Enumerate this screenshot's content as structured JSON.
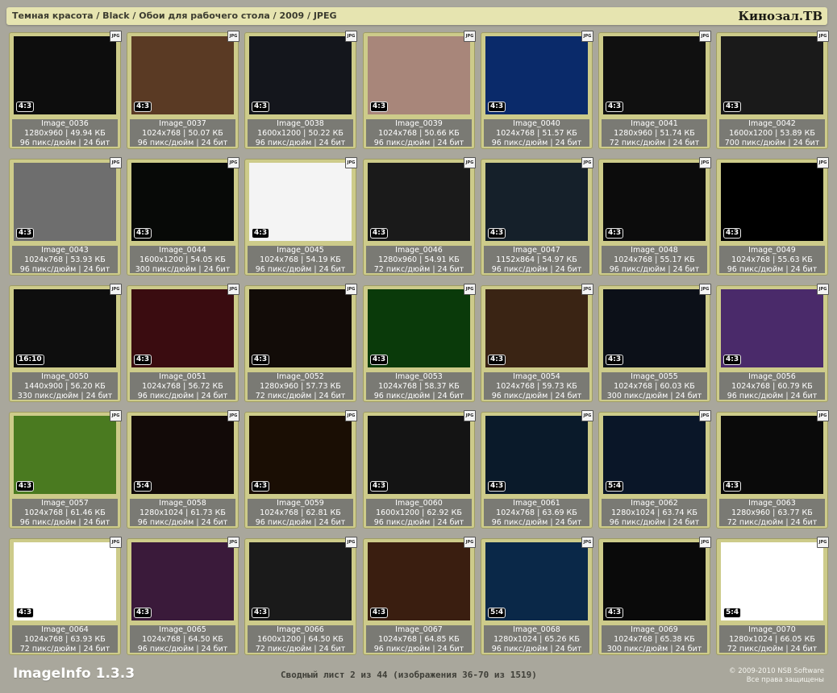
{
  "header": {
    "breadcrumb": "Темная красота / Black / Обои для рабочего стола / 2009 / JPEG",
    "logo": "Кинозал.ТВ"
  },
  "images": [
    {
      "name": "Image_0036",
      "dims": "1280x960 | 49.94 КБ",
      "meta": "96 пикс/дюйм | 24 бит",
      "ratio": "4:3",
      "fmt": "JPG",
      "bg": "#0d0d0d"
    },
    {
      "name": "Image_0037",
      "dims": "1024x768 | 50.07 КБ",
      "meta": "96 пикс/дюйм | 24 бит",
      "ratio": "4:3",
      "fmt": "JPG",
      "bg": "#5a3a24"
    },
    {
      "name": "Image_0038",
      "dims": "1600x1200 | 50.22 КБ",
      "meta": "96 пикс/дюйм | 24 бит",
      "ratio": "4:3",
      "fmt": "JPG",
      "bg": "#14161c"
    },
    {
      "name": "Image_0039",
      "dims": "1024x768 | 50.66 КБ",
      "meta": "96 пикс/дюйм | 24 бит",
      "ratio": "4:3",
      "fmt": "JPG",
      "bg": "#a8867a"
    },
    {
      "name": "Image_0040",
      "dims": "1024x768 | 51.57 КБ",
      "meta": "96 пикс/дюйм | 24 бит",
      "ratio": "4:3",
      "fmt": "JPG",
      "bg": "#0a2a6a"
    },
    {
      "name": "Image_0041",
      "dims": "1280x960 | 51.74 КБ",
      "meta": "72 пикс/дюйм | 24 бит",
      "ratio": "4:3",
      "fmt": "JPG",
      "bg": "#101010"
    },
    {
      "name": "Image_0042",
      "dims": "1600x1200 | 53.89 КБ",
      "meta": "700 пикс/дюйм | 24 бит",
      "ratio": "4:3",
      "fmt": "JPG",
      "bg": "#1a1a1a"
    },
    {
      "name": "Image_0043",
      "dims": "1024x768 | 53.93 КБ",
      "meta": "96 пикс/дюйм | 24 бит",
      "ratio": "4:3",
      "fmt": "JPG",
      "bg": "#6e6e6e"
    },
    {
      "name": "Image_0044",
      "dims": "1600x1200 | 54.05 КБ",
      "meta": "300 пикс/дюйм | 24 бит",
      "ratio": "4:3",
      "fmt": "JPG",
      "bg": "#070907"
    },
    {
      "name": "Image_0045",
      "dims": "1024x768 | 54.19 КБ",
      "meta": "96 пикс/дюйм | 24 бит",
      "ratio": "4:3",
      "fmt": "JPG",
      "bg": "#f4f4f4"
    },
    {
      "name": "Image_0046",
      "dims": "1280x960 | 54.91 КБ",
      "meta": "72 пикс/дюйм | 24 бит",
      "ratio": "4:3",
      "fmt": "JPG",
      "bg": "#1a1a1a"
    },
    {
      "name": "Image_0047",
      "dims": "1152x864 | 54.97 КБ",
      "meta": "96 пикс/дюйм | 24 бит",
      "ratio": "4:3",
      "fmt": "JPG",
      "bg": "#15202a"
    },
    {
      "name": "Image_0048",
      "dims": "1024x768 | 55.17 КБ",
      "meta": "96 пикс/дюйм | 24 бит",
      "ratio": "4:3",
      "fmt": "JPG",
      "bg": "#0c0c0c"
    },
    {
      "name": "Image_0049",
      "dims": "1024x768 | 55.63 КБ",
      "meta": "96 пикс/дюйм | 24 бит",
      "ratio": "4:3",
      "fmt": "JPG",
      "bg": "#000000"
    },
    {
      "name": "Image_0050",
      "dims": "1440x900 | 56.20 КБ",
      "meta": "330 пикс/дюйм | 24 бит",
      "ratio": "16:10",
      "fmt": "JPG",
      "bg": "#0e0e0e"
    },
    {
      "name": "Image_0051",
      "dims": "1024x768 | 56.72 КБ",
      "meta": "96 пикс/дюйм | 24 бит",
      "ratio": "4:3",
      "fmt": "JPG",
      "bg": "#3a0c10"
    },
    {
      "name": "Image_0052",
      "dims": "1280x960 | 57.73 КБ",
      "meta": "72 пикс/дюйм | 24 бит",
      "ratio": "4:3",
      "fmt": "JPG",
      "bg": "#120c08"
    },
    {
      "name": "Image_0053",
      "dims": "1024x768 | 58.37 КБ",
      "meta": "96 пикс/дюйм | 24 бит",
      "ratio": "4:3",
      "fmt": "JPG",
      "bg": "#0a3a0a"
    },
    {
      "name": "Image_0054",
      "dims": "1024x768 | 59.73 КБ",
      "meta": "96 пикс/дюйм | 24 бит",
      "ratio": "4:3",
      "fmt": "JPG",
      "bg": "#3a2414"
    },
    {
      "name": "Image_0055",
      "dims": "1024x768 | 60.03 КБ",
      "meta": "300 пикс/дюйм | 24 бит",
      "ratio": "4:3",
      "fmt": "JPG",
      "bg": "#0c1018"
    },
    {
      "name": "Image_0056",
      "dims": "1024x768 | 60.79 КБ",
      "meta": "96 пикс/дюйм | 24 бит",
      "ratio": "4:3",
      "fmt": "JPG",
      "bg": "#4a2a6a"
    },
    {
      "name": "Image_0057",
      "dims": "1024x768 | 61.46 КБ",
      "meta": "96 пикс/дюйм | 24 бит",
      "ratio": "4:3",
      "fmt": "JPG",
      "bg": "#4a7a20"
    },
    {
      "name": "Image_0058",
      "dims": "1280x1024 | 61.73 КБ",
      "meta": "96 пикс/дюйм | 24 бит",
      "ratio": "5:4",
      "fmt": "JPG",
      "bg": "#120a08"
    },
    {
      "name": "Image_0059",
      "dims": "1024x768 | 62.81 КБ",
      "meta": "96 пикс/дюйм | 24 бит",
      "ratio": "4:3",
      "fmt": "JPG",
      "bg": "#1a0e04"
    },
    {
      "name": "Image_0060",
      "dims": "1600x1200 | 62.92 КБ",
      "meta": "96 пикс/дюйм | 24 бит",
      "ratio": "4:3",
      "fmt": "JPG",
      "bg": "#141414"
    },
    {
      "name": "Image_0061",
      "dims": "1024x768 | 63.69 КБ",
      "meta": "96 пикс/дюйм | 24 бит",
      "ratio": "4:3",
      "fmt": "JPG",
      "bg": "#0a1a2a"
    },
    {
      "name": "Image_0062",
      "dims": "1280x1024 | 63.74 КБ",
      "meta": "96 пикс/дюйм | 24 бит",
      "ratio": "5:4",
      "fmt": "JPG",
      "bg": "#0a1628"
    },
    {
      "name": "Image_0063",
      "dims": "1280x960 | 63.77 КБ",
      "meta": "72 пикс/дюйм | 24 бит",
      "ratio": "4:3",
      "fmt": "JPG",
      "bg": "#0a0a0a"
    },
    {
      "name": "Image_0064",
      "dims": "1024x768 | 63.93 КБ",
      "meta": "72 пикс/дюйм | 24 бит",
      "ratio": "4:3",
      "fmt": "JPG",
      "bg": "#ffffff"
    },
    {
      "name": "Image_0065",
      "dims": "1024x768 | 64.50 КБ",
      "meta": "96 пикс/дюйм | 24 бит",
      "ratio": "4:3",
      "fmt": "JPG",
      "bg": "#3a1a3a"
    },
    {
      "name": "Image_0066",
      "dims": "1600x1200 | 64.50 КБ",
      "meta": "72 пикс/дюйм | 24 бит",
      "ratio": "4:3",
      "fmt": "JPG",
      "bg": "#1a1a1a"
    },
    {
      "name": "Image_0067",
      "dims": "1024x768 | 64.85 КБ",
      "meta": "96 пикс/дюйм | 24 бит",
      "ratio": "4:3",
      "fmt": "JPG",
      "bg": "#3a1e10"
    },
    {
      "name": "Image_0068",
      "dims": "1280x1024 | 65.26 КБ",
      "meta": "96 пикс/дюйм | 24 бит",
      "ratio": "5:4",
      "fmt": "JPG",
      "bg": "#0a2848"
    },
    {
      "name": "Image_0069",
      "dims": "1024x768 | 65.38 КБ",
      "meta": "300 пикс/дюйм | 24 бит",
      "ratio": "4:3",
      "fmt": "JPG",
      "bg": "#0a0a0a"
    },
    {
      "name": "Image_0070",
      "dims": "1280x1024 | 66.05 КБ",
      "meta": "72 пикс/дюйм | 24 бит",
      "ratio": "5:4",
      "fmt": "JPG",
      "bg": "#ffffff"
    }
  ],
  "footer": {
    "app_name": "ImageInfo 1.3.3",
    "summary": "Сводный лист 2 из 44 (изображения 36-70 из 1519)",
    "copyright": "© 2009-2010 NSB Software",
    "rights": "Все права защищены"
  }
}
